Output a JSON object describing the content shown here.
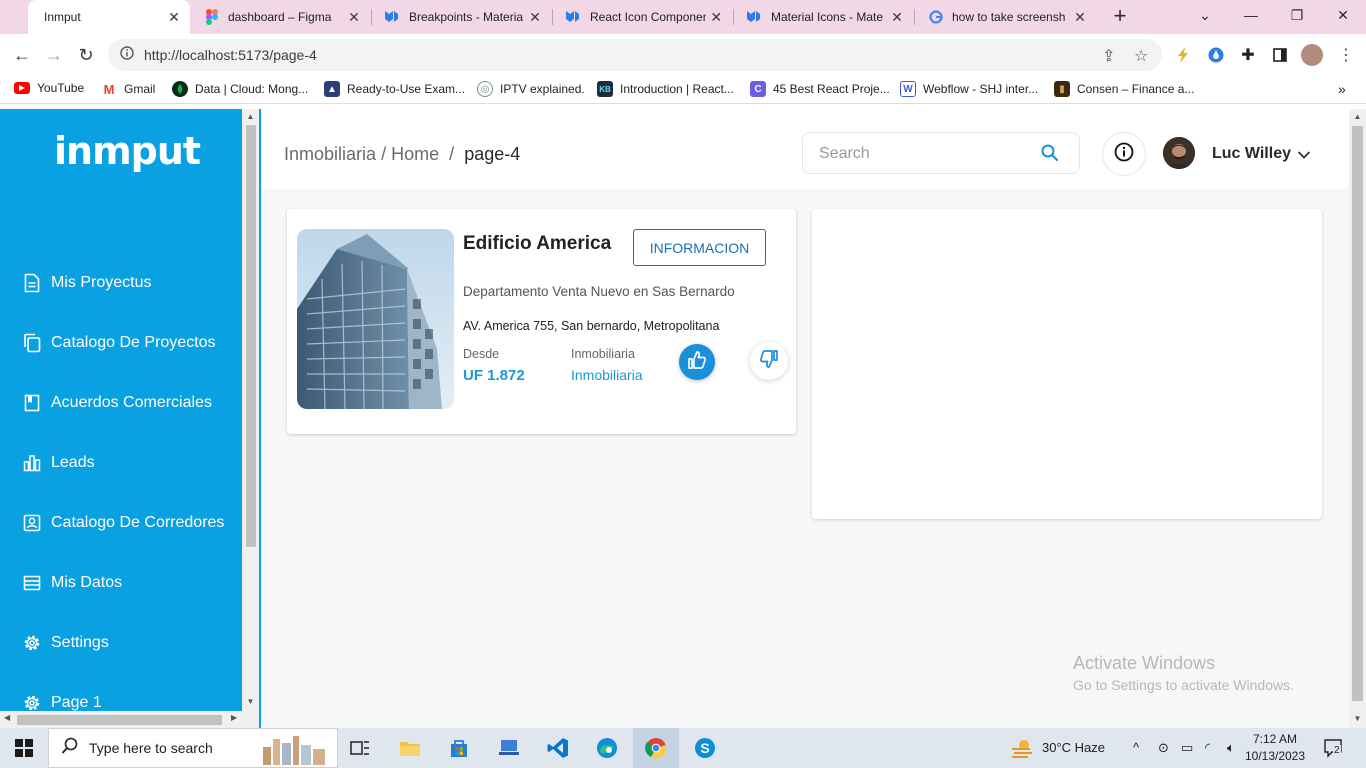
{
  "browser": {
    "tabs": [
      {
        "title": "Inmput",
        "active": true
      },
      {
        "title": "dashboard – Figma",
        "active": false
      },
      {
        "title": "Breakpoints - Materia",
        "active": false
      },
      {
        "title": "React Icon Componen",
        "active": false
      },
      {
        "title": "Material Icons - Mate",
        "active": false
      },
      {
        "title": "how to take screensh",
        "active": false
      }
    ],
    "url": "http://localhost:5173/page-4",
    "bookmarks": [
      {
        "label": "YouTube"
      },
      {
        "label": "Gmail"
      },
      {
        "label": "Data | Cloud: Mong..."
      },
      {
        "label": "Ready-to-Use Exam..."
      },
      {
        "label": "IPTV explained."
      },
      {
        "label": "Introduction | React..."
      },
      {
        "label": "45 Best React Proje..."
      },
      {
        "label": "Webflow - SHJ inter..."
      },
      {
        "label": "Consen – Finance a..."
      }
    ]
  },
  "sidebar": {
    "logo": "inmput",
    "items": [
      {
        "label": "Mis Proyectus",
        "icon": "document-icon"
      },
      {
        "label": "Catalogo De Proyectos",
        "icon": "copy-icon"
      },
      {
        "label": "Acuerdos Comerciales",
        "icon": "book-icon"
      },
      {
        "label": "Leads",
        "icon": "bar-chart-icon"
      },
      {
        "label": "Catalogo De Corredores",
        "icon": "contact-card-icon"
      },
      {
        "label": "Mis Datos",
        "icon": "list-icon"
      },
      {
        "label": "Settings",
        "icon": "gear-icon"
      },
      {
        "label": "Page 1",
        "icon": "gear-icon"
      }
    ]
  },
  "header": {
    "breadcrumb": {
      "root": "Inmobiliaria",
      "sep1": "/",
      "home": "Home",
      "sep2": "/",
      "current": "page-4"
    },
    "search_placeholder": "Search",
    "user_name": "Luc Willey"
  },
  "property_card": {
    "title": "Edificio America",
    "button_label": "INFORMACION",
    "subtitle": "Departamento Venta Nuevo en Sas Bernardo",
    "address": "AV. America 755, San bernardo, Metropolitana",
    "price_label": "Desde",
    "price_value": "UF 1.872",
    "agency_label": "Inmobiliaria",
    "agency_value": "Inmobiliaria"
  },
  "watermark": {
    "line1": "Activate Windows",
    "line2": "Go to Settings to activate Windows."
  },
  "taskbar": {
    "search_placeholder": "Type here to search",
    "weather": "30°C  Haze",
    "time": "7:12 AM",
    "date": "10/13/2023",
    "notification_count": "2"
  },
  "colors": {
    "sidebar_bg": "#0aa1e2",
    "accent": "#1899d6",
    "tabbar_bg": "#f2d7e7"
  }
}
